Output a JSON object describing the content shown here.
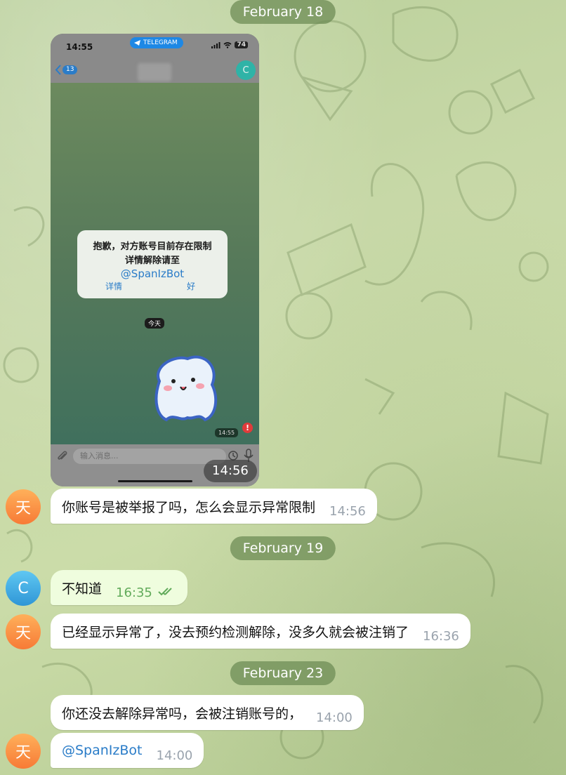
{
  "dates": {
    "feb18": "February 18",
    "feb19": "February 19",
    "feb23": "February 23"
  },
  "avatars": {
    "tian": "天",
    "c": "C"
  },
  "screenshot_message": {
    "time": "14:56",
    "phone": {
      "status_time": "14:55",
      "app_badge": "TELEGRAM",
      "battery": "74",
      "back_count": "13",
      "contact_initial": "C",
      "dialog_line1": "抱歉，对方账号目前存在限制",
      "dialog_line2": "详情解除请至",
      "dialog_link": "@SpanIzBot",
      "dialog_btn_details": "详情",
      "dialog_btn_ok": "好",
      "today_label": "今天",
      "sticker_time": "14:55",
      "error_mark": "!",
      "input_placeholder": "输入消息..."
    }
  },
  "messages": [
    {
      "text": "你账号是被举报了吗，怎么会显示异常限制",
      "time": "14:56"
    },
    {
      "text": "不知道",
      "time": "16:35"
    },
    {
      "text": "已经显示异常了，没去预约检测解除，没多久就会被注销了",
      "time": "16:36"
    },
    {
      "text": "你还没去解除异常吗，会被注销账号的，",
      "time": "14:00"
    },
    {
      "text": "@SpanIzBot",
      "time": "14:00"
    }
  ],
  "colors": {
    "incoming_bubble": "#ffffff",
    "outgoing_bubble": "#effdde",
    "date_pill": "#6e8c55",
    "link": "#2a7cc8",
    "read_check": "#62ab5b"
  }
}
